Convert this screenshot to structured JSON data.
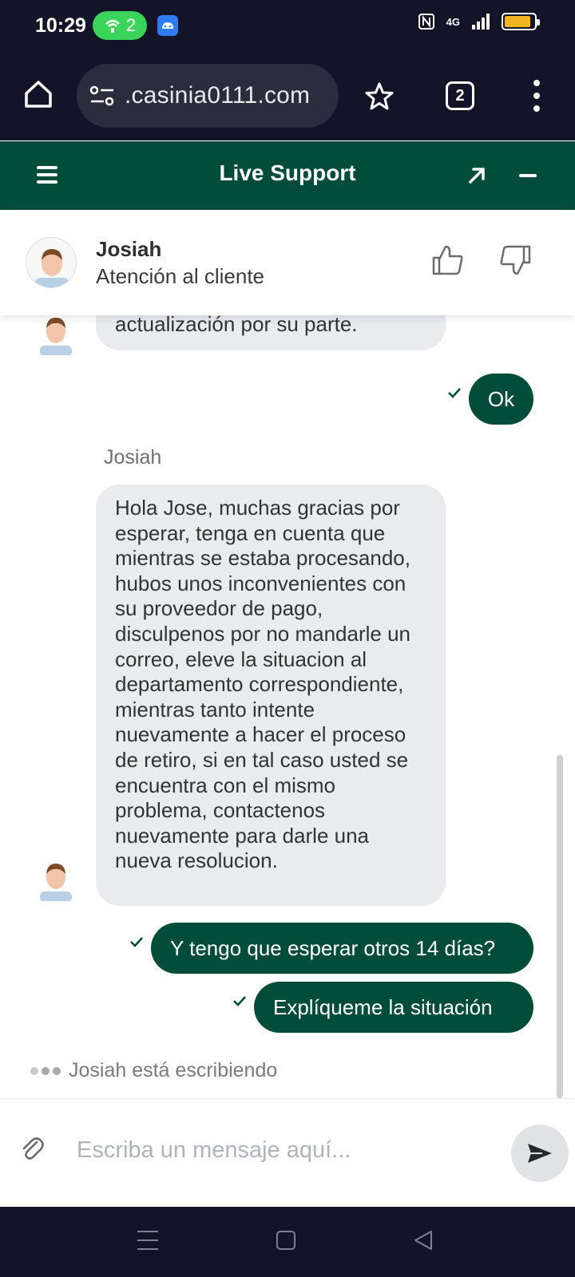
{
  "status_bar": {
    "time": "10:29",
    "hotspot_count": "2",
    "network": "4G",
    "icons": [
      "hotspot-icon",
      "android-app-icon",
      "nfc-icon",
      "signal-icon",
      "battery-icon"
    ],
    "battery_level": 0.9
  },
  "browser": {
    "url": ".casinia0111.com",
    "tab_count": "2",
    "icons": [
      "home-icon",
      "site-settings-icon",
      "star-icon",
      "tabs-icon",
      "more-icon"
    ]
  },
  "header": {
    "title": "Live Support",
    "icons": [
      "menu-icon",
      "expand-icon",
      "minimize-icon"
    ],
    "background": "#024c3a"
  },
  "agent": {
    "name": "Josiah",
    "role": "Atención al cliente",
    "icons": [
      "thumbs-up-icon",
      "thumbs-down-icon"
    ]
  },
  "messages": [
    {
      "from": "agent",
      "text": "actualización por su parte."
    },
    {
      "from": "user",
      "text": "Ok"
    },
    {
      "from": "agent",
      "sender": "Josiah",
      "text": "Hola Jose, muchas gracias por esperar, tenga en cuenta que mientras se estaba procesando, hubos unos inconvenientes con su proveedor de pago, disculpenos por no mandarle un correo, eleve la situacion al departamento correspondiente, mientras tanto intente nuevamente a hacer el proceso de retiro, si en tal caso usted se encuentra con el mismo problema, contactenos nuevamente para darle una nueva resolucion."
    },
    {
      "from": "user",
      "text": "Y tengo que esperar otros 14 días?"
    },
    {
      "from": "user",
      "text": "Explíqueme la situación"
    }
  ],
  "typing_indicator": "Josiah está escribiendo",
  "composer": {
    "placeholder": "Escriba un mensaje aquí...",
    "icons": [
      "paperclip-icon",
      "send-icon"
    ]
  },
  "nav_bar": {
    "icons": [
      "recents-icon",
      "home-icon",
      "back-icon"
    ]
  },
  "colors": {
    "accent": "#024c3a",
    "incoming_bubble": "#e9ebee",
    "system_bar": "#141428"
  }
}
